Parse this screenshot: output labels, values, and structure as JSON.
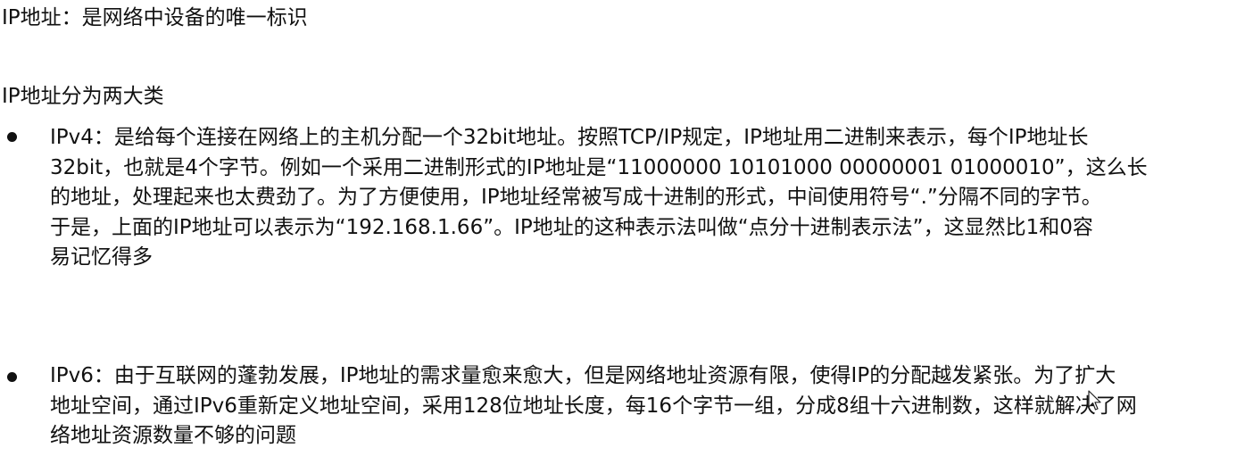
{
  "heading_definition": "IP地址：是网络中设备的唯一标识",
  "heading_categories": "IP地址分为两大类",
  "ipv4_lines": [
    "IPv4：是给每个连接在网络上的主机分配一个32bit地址。按照TCP/IP规定，IP地址用二进制来表示，每个IP地址长",
    "32bit，也就是4个字节。例如一个采用二进制形式的IP地址是“11000000 10101000 00000001 01000010”，这么长",
    "的地址，处理起来也太费劲了。为了方便使用，IP地址经常被写成十进制的形式，中间使用符号“.”分隔不同的字节。",
    "于是，上面的IP地址可以表示为“192.168.1.66”。IP地址的这种表示法叫做“点分十进制表示法”，这显然比1和0容",
    "易记忆得多"
  ],
  "ipv6_lines": [
    "IPv6：由于互联网的蓬勃发展，IP地址的需求量愈来愈大，但是网络地址资源有限，使得IP的分配越发紧张。为了扩大",
    "地址空间，通过IPv6重新定义地址空间，采用128位地址长度，每16个字节一组，分成8组十六进制数，这样就解决了网",
    "络地址资源数量不够的问题"
  ],
  "icons": {
    "bullet": "filled-circle",
    "cursor": "mouse-pointer-icon"
  },
  "colors": {
    "text": "#111111",
    "background": "#ffffff"
  }
}
